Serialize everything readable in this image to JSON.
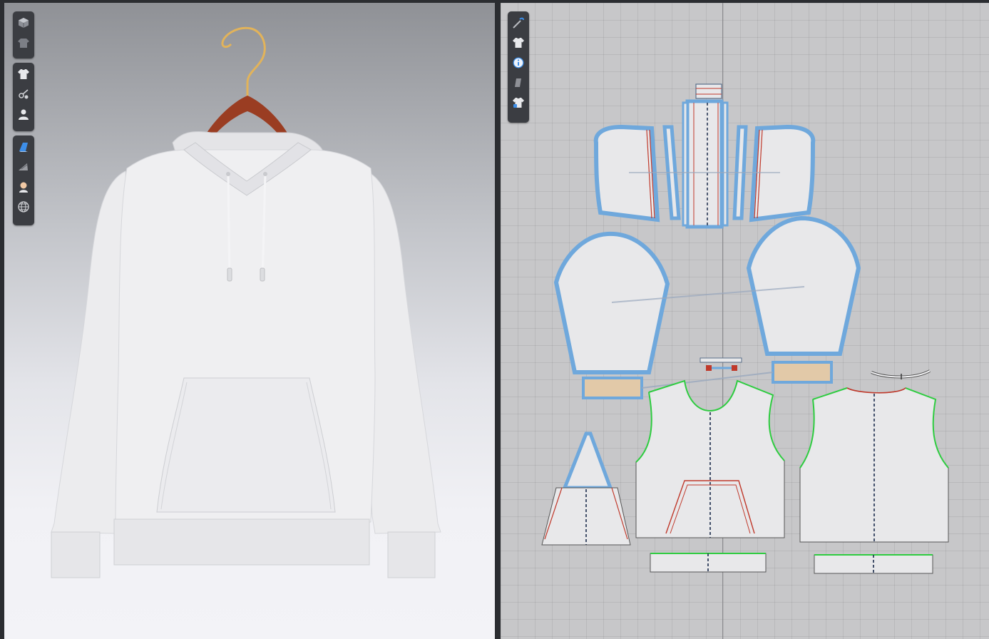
{
  "app": {
    "accent_color": "#3d8ee8",
    "panel_color": "#3b3d42"
  },
  "viewport_3d": {
    "toolbar_groups": [
      [
        {
          "name": "avatar-cube-icon"
        },
        {
          "name": "garment-ghost-icon"
        }
      ],
      [
        {
          "name": "shirt-icon"
        },
        {
          "name": "pin-tools-icon"
        },
        {
          "name": "avatar-person-icon"
        }
      ],
      [
        {
          "name": "fabric-roll-icon",
          "active": true
        },
        {
          "name": "iron-icon"
        },
        {
          "name": "skin-face-icon"
        },
        {
          "name": "globe-icon"
        }
      ]
    ],
    "garment_color": "#ececee",
    "hanger_color": "#9a3d22",
    "hook_color": "#e2b35a"
  },
  "viewport_2d": {
    "toolbar": [
      {
        "name": "pen-tool-icon"
      },
      {
        "name": "shirt-2d-icon"
      },
      {
        "name": "info-icon"
      },
      {
        "name": "eraser-icon"
      },
      {
        "name": "garment-lock-icon"
      }
    ],
    "pattern_colors": {
      "selected_outline": "#6fa8dc",
      "seam_line": "#c0392b",
      "sewn_edge": "#2ecc40",
      "center_line": "#1a2a4a",
      "piece_fill": "#e8e8ea",
      "rib_fill": "#e2c9a8"
    }
  }
}
